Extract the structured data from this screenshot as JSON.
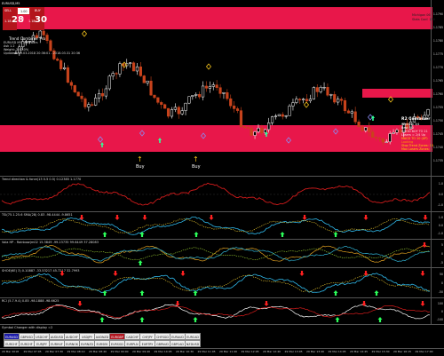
{
  "window": {
    "symbol_title": "EURUSD,M5"
  },
  "trade_panel": {
    "sell_label": "SELL",
    "buy_label": "BUY",
    "lot_value": "1.00",
    "sell_price_small": "1.18",
    "sell_price_big": "28",
    "sell_price_sup": "1",
    "buy_price_small": "1.18",
    "buy_price_big": "30",
    "buy_price_sup": "1"
  },
  "chart_info": {
    "indicator_title": "Trend Combiner Pro",
    "lines": [
      "EURUSD M5 3005 bars",
      "Ask 1.2",
      "Weight: 3.00.0%",
      "",
      "Updated: 29.03.2018 20:36:01 - 2018.03.31 20:36"
    ]
  },
  "top_zone": {
    "line1": "Michigan 06",
    "line2": "Stats Conf.   150"
  },
  "combiner_box": {
    "title": "R2 Combiner",
    "lines": [
      {
        "text": "Winning 3/4",
        "color": "#ffffff"
      },
      {
        "text": "Best RSI",
        "color": "#ffffff"
      },
      {
        "text": "GOOD BUY TO 21",
        "color": "#ff3b30"
      },
      {
        "text": "Losers = 2/4 Up",
        "color": "#ff3b30"
      },
      {
        "text": "MACD TO 10 (UP)",
        "color": "#ffd400"
      },
      {
        "text": "Looking",
        "color": "#ff9900"
      },
      {
        "text": "Stop Trend Zones: 10",
        "color": "#ffd400"
      },
      {
        "text": "Max Losers Zones: 1",
        "color": "#ffd400"
      }
    ]
  },
  "signals": [
    {
      "label": "Buy"
    },
    {
      "label": "Buy"
    }
  ],
  "price_scale": [
    "1.1790",
    "1.1785",
    "1.1780",
    "1.1775",
    "1.1770",
    "1.1765",
    "1.1760",
    "1.1755",
    "1.1750",
    "1.1745",
    "1.1740",
    "1.1735"
  ],
  "panels": [
    {
      "title": "Trend direction & force(13 0.5 0.5) 0.12385 1.1770",
      "scale": [
        "1.0",
        "0.0",
        "-1.0"
      ]
    },
    {
      "title": "TSI(75.1.25.6 SMA(28) 0.83 -98.4444 -9.8651",
      "scale": [
        "1.0",
        "0.0",
        "-1.0"
      ]
    },
    {
      "title": "Vola HP - Rainbow(m02 15.3849 -99.23735 99.6449 37.28083",
      "scale": [
        "5",
        "0",
        "-5"
      ]
    },
    {
      "title": "SHOE(6E) 3) 0.10887 -33.53217 45.7217 32.7993",
      "scale": [
        "50",
        "0",
        "-50"
      ]
    },
    {
      "title": "RCI (5.7.9.4) 0.85 -98.1888 -98.6625",
      "scale": [
        "100",
        "0",
        "-100"
      ]
    }
  ],
  "symbols_panel": {
    "title": "Symbol Changer with display =2",
    "row1": [
      "EURUSD",
      "GBPUSD",
      "USDCHF",
      "AUDUSD",
      "AUDCHF",
      "USDJPY",
      "AUDNZD",
      "EURGBP",
      "CADCHF",
      "CHFJPY",
      "CHFSGD",
      "EURAUD",
      "EURCAD"
    ],
    "row2": [
      "EURCHF",
      "EURCHF",
      "EURJPY",
      "EURHUF",
      "EURNOK",
      "EURNZD",
      "EURSEK",
      "EURSGD",
      "EURPLN",
      "EURTRY",
      "GBPAUD",
      "GBPCAD",
      "NZDUSD"
    ],
    "active_blue": 0,
    "active_red": 7
  },
  "time_axis": [
    "29 Mar 2018",
    "29 Mar 07:05",
    "29 Mar 07:30",
    "29 Mar 08:10",
    "29 Mar 08:40",
    "29 Mar 09:00",
    "29 Mar 09:40",
    "29 Mar 10:05",
    "29 Mar 10:30",
    "29 Mar 11:05",
    "29 Mar 11:40",
    "29 Mar 12:05",
    "29 Mar 12:40",
    "29 Mar 13:05",
    "29 Mar 13:40",
    "29 Mar 14:05",
    "29 Mar 14:45",
    "29 Mar 15:30",
    "29 Mar 16:15",
    "29 Mar 17:00"
  ],
  "colors": {
    "zone": "#e8174a",
    "bull": "#ffffff",
    "bear": "#c8431c",
    "signal_yellow": "#f3c21c",
    "grid": "#333333"
  }
}
